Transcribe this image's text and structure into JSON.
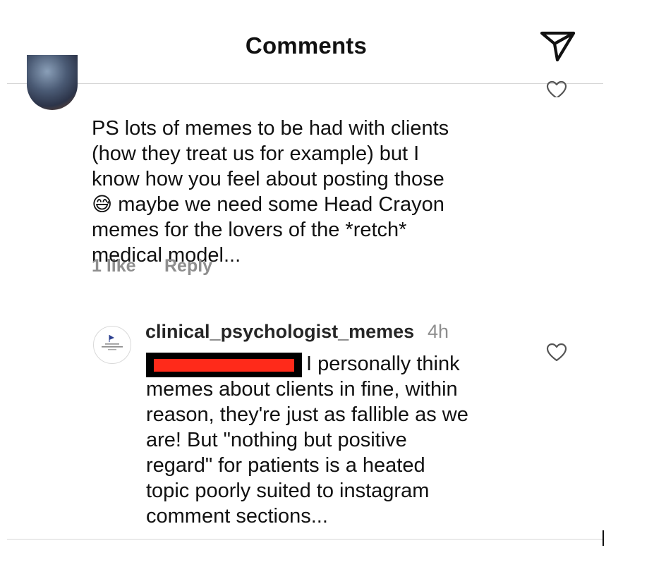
{
  "header": {
    "title": "Comments",
    "send_icon": "paper-plane-icon"
  },
  "comment1": {
    "text": "PS lots of memes to be had with clients\n(how they treat us for example) but I\nknow how you feel about posting those",
    "emoji": "😅",
    "text_after_emoji": "maybe we need some Head Crayon\nmemes for the lovers of the *retch*\nmedical model...",
    "likes": "1 like",
    "reply_label": "Reply"
  },
  "comment2": {
    "username": "clinical_psychologist_memes",
    "time": "4h",
    "text_first_line": "I personally think",
    "text_rest": "memes about clients in fine, within\nreason, they're just as fallible as we\nare! But \"nothing but positive\nregard\" for patients is a heated\ntopic poorly suited to instagram\ncomment sections..."
  },
  "colors": {
    "meta_gray": "#8e8e8e",
    "redaction_red": "#ff2a1a"
  }
}
